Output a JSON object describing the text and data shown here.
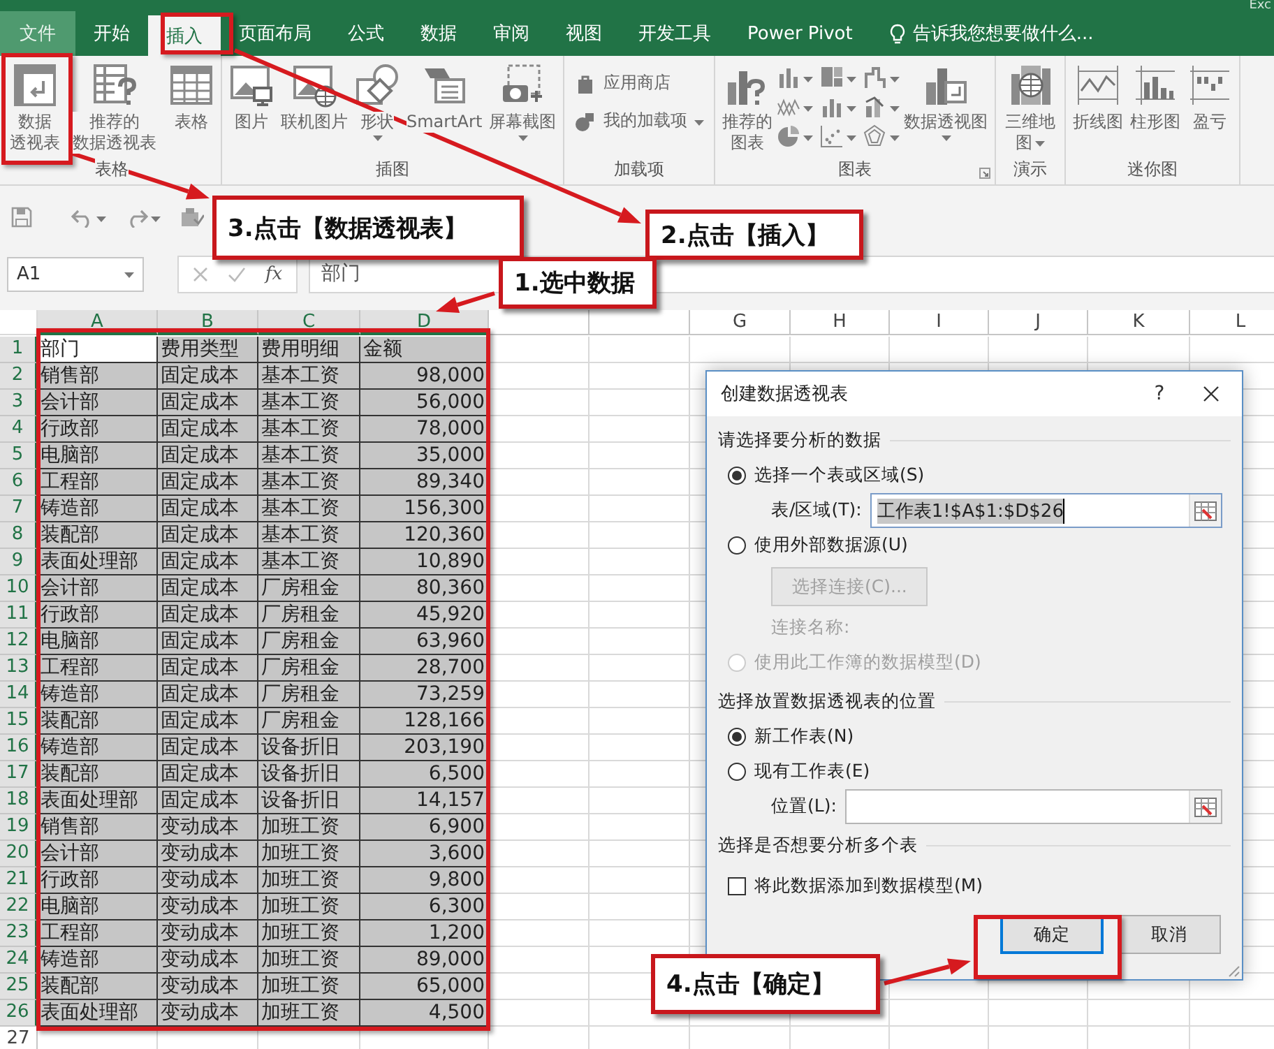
{
  "window": {
    "title": "Exc"
  },
  "ribbon_tabs": [
    {
      "label": "文件",
      "kind": "file",
      "selected": false
    },
    {
      "label": "开始",
      "kind": "tab",
      "selected": false
    },
    {
      "label": "插入",
      "kind": "tab",
      "selected": true
    },
    {
      "label": "页面布局",
      "kind": "tab",
      "selected": false
    },
    {
      "label": "公式",
      "kind": "tab",
      "selected": false
    },
    {
      "label": "数据",
      "kind": "tab",
      "selected": false
    },
    {
      "label": "审阅",
      "kind": "tab",
      "selected": false
    },
    {
      "label": "视图",
      "kind": "tab",
      "selected": false
    },
    {
      "label": "开发工具",
      "kind": "tab",
      "selected": false
    },
    {
      "label": "Power Pivot",
      "kind": "tab",
      "selected": false
    }
  ],
  "tell_me": {
    "placeholder": "告诉我您想要做什么..."
  },
  "ribbon_groups": [
    {
      "label": "表格",
      "commands": [
        {
          "kind": "large",
          "lines": [
            "数据",
            "透视表"
          ]
        },
        {
          "kind": "large",
          "lines": [
            "推荐的",
            "数据透视表"
          ]
        },
        {
          "kind": "large",
          "lines": [
            "表格"
          ]
        }
      ]
    },
    {
      "label": "插图",
      "commands": [
        {
          "kind": "large",
          "lines": [
            "图片"
          ]
        },
        {
          "kind": "large",
          "lines": [
            "联机图片"
          ]
        },
        {
          "kind": "large",
          "lines": [
            "形状"
          ],
          "dropdown": true
        },
        {
          "kind": "large",
          "lines": [
            "SmartArt"
          ]
        },
        {
          "kind": "large",
          "lines": [
            "屏幕截图"
          ],
          "dropdown": true
        }
      ]
    },
    {
      "label": "加载项",
      "commands": [
        {
          "kind": "small",
          "lines": [
            "应用商店"
          ]
        },
        {
          "kind": "small",
          "lines": [
            "我的加载项"
          ],
          "dropdown": true
        }
      ]
    },
    {
      "label": "图表",
      "launcher": true,
      "commands": [
        {
          "kind": "large",
          "lines": [
            "推荐的",
            "图表"
          ]
        },
        {
          "kind": "gallery"
        },
        {
          "kind": "large",
          "lines": [
            "数据透视图"
          ],
          "dropdown": true
        }
      ]
    },
    {
      "label": "演示",
      "commands": [
        {
          "kind": "large",
          "lines": [
            "三维地",
            "图"
          ],
          "dropdown": true
        }
      ]
    },
    {
      "label": "迷你图",
      "commands": [
        {
          "kind": "large",
          "lines": [
            "折线图"
          ]
        },
        {
          "kind": "large",
          "lines": [
            "柱形图"
          ]
        },
        {
          "kind": "large",
          "lines": [
            "盈亏"
          ]
        }
      ]
    }
  ],
  "formula_bar": {
    "name_box": "A1",
    "function_label": "fx",
    "value": "部门"
  },
  "columns": [
    {
      "label": "A",
      "selected": true
    },
    {
      "label": "B",
      "selected": true
    },
    {
      "label": "C",
      "selected": true
    },
    {
      "label": "D",
      "selected": true
    },
    {
      "selected": false
    },
    {
      "selected": false
    },
    {
      "label": "G",
      "selected": false
    },
    {
      "label": "H",
      "selected": false
    },
    {
      "label": "I",
      "selected": false
    },
    {
      "label": "J",
      "selected": false
    },
    {
      "label": "K",
      "selected": false
    },
    {
      "label": "L",
      "selected": false
    }
  ],
  "rows": [
    {
      "number": "1",
      "selected": true,
      "active": true,
      "cells": [
        "部门",
        "费用类型",
        "费用明细",
        "金额"
      ]
    },
    {
      "number": "2",
      "selected": true,
      "cells": [
        "销售部",
        "固定成本",
        "基本工资",
        "98,000"
      ]
    },
    {
      "number": "3",
      "selected": true,
      "cells": [
        "会计部",
        "固定成本",
        "基本工资",
        "56,000"
      ]
    },
    {
      "number": "4",
      "selected": true,
      "cells": [
        "行政部",
        "固定成本",
        "基本工资",
        "78,000"
      ]
    },
    {
      "number": "5",
      "selected": true,
      "cells": [
        "电脑部",
        "固定成本",
        "基本工资",
        "35,000"
      ]
    },
    {
      "number": "6",
      "selected": true,
      "cells": [
        "工程部",
        "固定成本",
        "基本工资",
        "89,340"
      ]
    },
    {
      "number": "7",
      "selected": true,
      "cells": [
        "铸造部",
        "固定成本",
        "基本工资",
        "156,300"
      ]
    },
    {
      "number": "8",
      "selected": true,
      "cells": [
        "装配部",
        "固定成本",
        "基本工资",
        "120,360"
      ]
    },
    {
      "number": "9",
      "selected": true,
      "cells": [
        "表面处理部",
        "固定成本",
        "基本工资",
        "10,890"
      ]
    },
    {
      "number": "10",
      "selected": true,
      "cells": [
        "会计部",
        "固定成本",
        "厂房租金",
        "80,360"
      ]
    },
    {
      "number": "11",
      "selected": true,
      "cells": [
        "行政部",
        "固定成本",
        "厂房租金",
        "45,920"
      ]
    },
    {
      "number": "12",
      "selected": true,
      "cells": [
        "电脑部",
        "固定成本",
        "厂房租金",
        "63,960"
      ]
    },
    {
      "number": "13",
      "selected": true,
      "cells": [
        "工程部",
        "固定成本",
        "厂房租金",
        "28,700"
      ]
    },
    {
      "number": "14",
      "selected": true,
      "cells": [
        "铸造部",
        "固定成本",
        "厂房租金",
        "73,259"
      ]
    },
    {
      "number": "15",
      "selected": true,
      "cells": [
        "装配部",
        "固定成本",
        "厂房租金",
        "128,166"
      ]
    },
    {
      "number": "16",
      "selected": true,
      "cells": [
        "铸造部",
        "固定成本",
        "设备折旧",
        "203,190"
      ]
    },
    {
      "number": "17",
      "selected": true,
      "cells": [
        "装配部",
        "固定成本",
        "设备折旧",
        "6,500"
      ]
    },
    {
      "number": "18",
      "selected": true,
      "cells": [
        "表面处理部",
        "固定成本",
        "设备折旧",
        "14,157"
      ]
    },
    {
      "number": "19",
      "selected": true,
      "cells": [
        "销售部",
        "变动成本",
        "加班工资",
        "6,900"
      ]
    },
    {
      "number": "20",
      "selected": true,
      "cells": [
        "会计部",
        "变动成本",
        "加班工资",
        "3,600"
      ]
    },
    {
      "number": "21",
      "selected": true,
      "cells": [
        "行政部",
        "变动成本",
        "加班工资",
        "9,800"
      ]
    },
    {
      "number": "22",
      "selected": true,
      "cells": [
        "电脑部",
        "变动成本",
        "加班工资",
        "6,300"
      ]
    },
    {
      "number": "23",
      "selected": true,
      "cells": [
        "工程部",
        "变动成本",
        "加班工资",
        "1,200"
      ]
    },
    {
      "number": "24",
      "selected": true,
      "cells": [
        "铸造部",
        "变动成本",
        "加班工资",
        "89,000"
      ]
    },
    {
      "number": "25",
      "selected": true,
      "cells": [
        "装配部",
        "变动成本",
        "加班工资",
        "65,000"
      ]
    },
    {
      "number": "26",
      "selected": true,
      "cells": [
        "表面处理部",
        "变动成本",
        "加班工资",
        "4,500"
      ]
    },
    {
      "number": "27",
      "selected": false
    }
  ],
  "dialog": {
    "title": "创建数据透视表",
    "help": "?",
    "sections": [
      {
        "heading": "请选择要分析的数据",
        "items": [
          {
            "kind": "radio",
            "label": "选择一个表或区域(S)",
            "selected": true,
            "disabled": false
          },
          {
            "kind": "field",
            "label": "表/区域(T):",
            "value": "工作表1!$A$1:$D$26",
            "highlighted": true
          },
          {
            "kind": "radio",
            "label": "使用外部数据源(U)",
            "selected": false,
            "disabled": false
          },
          {
            "kind": "button",
            "label": "选择连接(C)...",
            "disabled": true
          },
          {
            "kind": "note",
            "label": "连接名称:",
            "disabled": true
          },
          {
            "kind": "radio",
            "label": "使用此工作簿的数据模型(D)",
            "selected": false,
            "disabled": true
          }
        ]
      },
      {
        "heading": "选择放置数据透视表的位置",
        "items": [
          {
            "kind": "radio",
            "label": "新工作表(N)",
            "selected": true,
            "disabled": false
          },
          {
            "kind": "radio",
            "label": "现有工作表(E)",
            "selected": false,
            "disabled": false
          },
          {
            "kind": "field",
            "label": "位置(L):",
            "highlighted": false
          }
        ]
      },
      {
        "heading": "选择是否想要分析多个表",
        "items": [
          {
            "kind": "checkbox",
            "label": "将此数据添加到数据模型(M)",
            "checked": false
          }
        ]
      }
    ],
    "buttons": [
      {
        "label": "确定",
        "default": true
      },
      {
        "label": "取消",
        "default": false
      }
    ]
  },
  "annotations": [
    {
      "text": "3.点击【数据透视表】"
    },
    {
      "text": "2.点击【插入】"
    },
    {
      "text": "1.选中数据"
    },
    {
      "text": "4.点击【确定】"
    }
  ]
}
